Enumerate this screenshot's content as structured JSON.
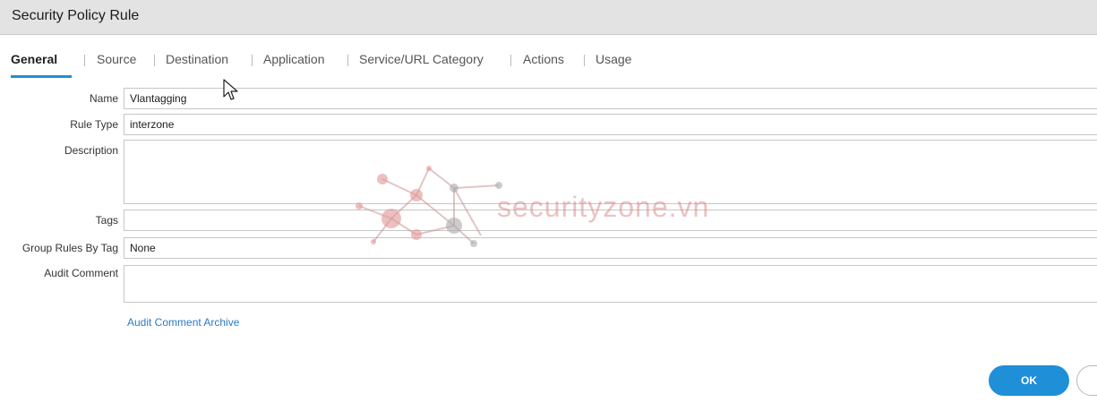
{
  "window": {
    "title": "Security Policy Rule"
  },
  "tabs": [
    {
      "label": "General"
    },
    {
      "label": "Source"
    },
    {
      "label": "Destination"
    },
    {
      "label": "Application"
    },
    {
      "label": "Service/URL Category"
    },
    {
      "label": "Actions"
    },
    {
      "label": "Usage"
    }
  ],
  "form": {
    "name": {
      "label": "Name",
      "value": "Vlantagging"
    },
    "rule_type": {
      "label": "Rule Type",
      "value": "interzone"
    },
    "description": {
      "label": "Description",
      "value": ""
    },
    "tags": {
      "label": "Tags",
      "value": ""
    },
    "group_rules_by_tag": {
      "label": "Group Rules By Tag",
      "value": "None"
    },
    "audit_comment": {
      "label": "Audit Comment",
      "value": ""
    },
    "audit_comment_archive_link": "Audit Comment Archive"
  },
  "buttons": {
    "ok": "OK"
  },
  "watermark": {
    "text": "securityzone.vn"
  },
  "colors": {
    "accent": "#1f8fd8",
    "link": "#2a7bc4",
    "titlebar": "#e3e3e3"
  }
}
